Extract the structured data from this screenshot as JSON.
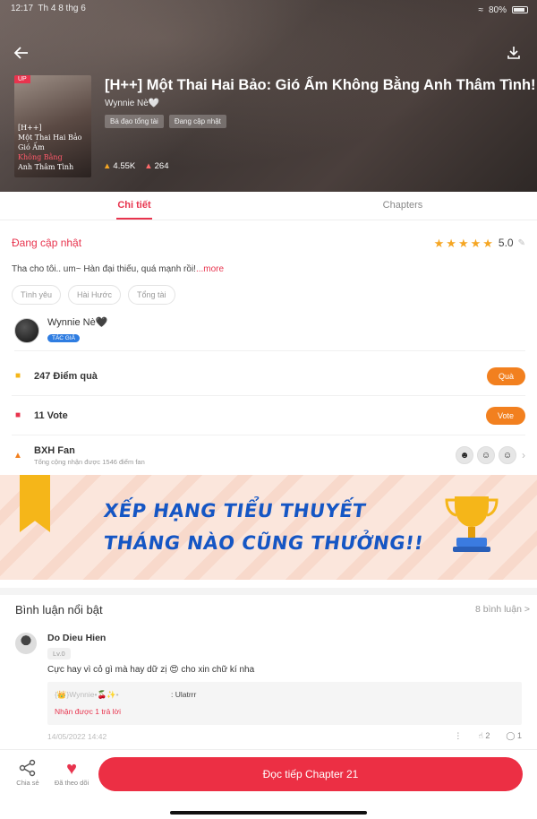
{
  "status_bar": {
    "time": "12:17",
    "date": "Th 4 8 thg 6",
    "battery": "80%"
  },
  "header": {
    "cover_badge": "UP",
    "cover_text": [
      "[H++]",
      "Một Thai Hai Bảo",
      "Gió Ấm",
      "Không Bằng",
      "Anh Thâm Tình"
    ],
    "title": "[H++] Một Thai Hai Bảo: Gió Ấm Không Bằng Anh Thâm Tình!",
    "author": "Wynnie Nè🤍",
    "chips": [
      "Bá đạo tổng tài",
      "Đang cập nhật"
    ],
    "views": "4.55K",
    "likes": "264"
  },
  "tabs": [
    "Chi tiết",
    "Chapters"
  ],
  "details": {
    "status": "Đang cập nhật",
    "rating": "5.0",
    "stars": 5,
    "description": "Tha cho tôi.. um~ Hàn đại thiếu, quá mạnh rồi!",
    "more": "...more",
    "genres": [
      "Tình yêu",
      "Hài Hước",
      "Tổng tài"
    ]
  },
  "author_block": {
    "name": "Wynnie Nè🖤",
    "badge": "TÁC GIẢ"
  },
  "gift_row": {
    "label": "247 Điểm quà",
    "button": "Quà"
  },
  "vote_row": {
    "label": "11 Vote",
    "button": "Vote"
  },
  "fan_row": {
    "label": "BXH Fan",
    "subtitle": "Tổng cộng nhận được 1546 điểm fan"
  },
  "banner": {
    "line1": "XẾP HẠNG TIỂU THUYẾT",
    "line2": "THÁNG NÀO CŨNG THƯỞNG!!"
  },
  "comments": {
    "title": "Bình luận nổi bật",
    "count": "8 bình luận >",
    "items": [
      {
        "name": "Do Dieu Hien",
        "level": "Lv.0",
        "text": "Cực hay vì cỏ gì mà hay dữ zị 😍 cho xin chữ kí nha",
        "reply_user": "{👑}Wynnie•🍒✨•",
        "reply_text": ": Ulatrrr",
        "reply_link": "Nhận được 1 trả lời",
        "date": "14/05/2022 14:42",
        "likes": "2",
        "replies": "1"
      }
    ]
  },
  "bottom_bar": {
    "share": "Chia sẻ",
    "follow": "Đã theo dõi",
    "read": "Đọc tiếp Chapter 21"
  },
  "colors": {
    "accent": "#e8344e",
    "orange": "#f2801f",
    "banner_text": "#1556c4"
  }
}
